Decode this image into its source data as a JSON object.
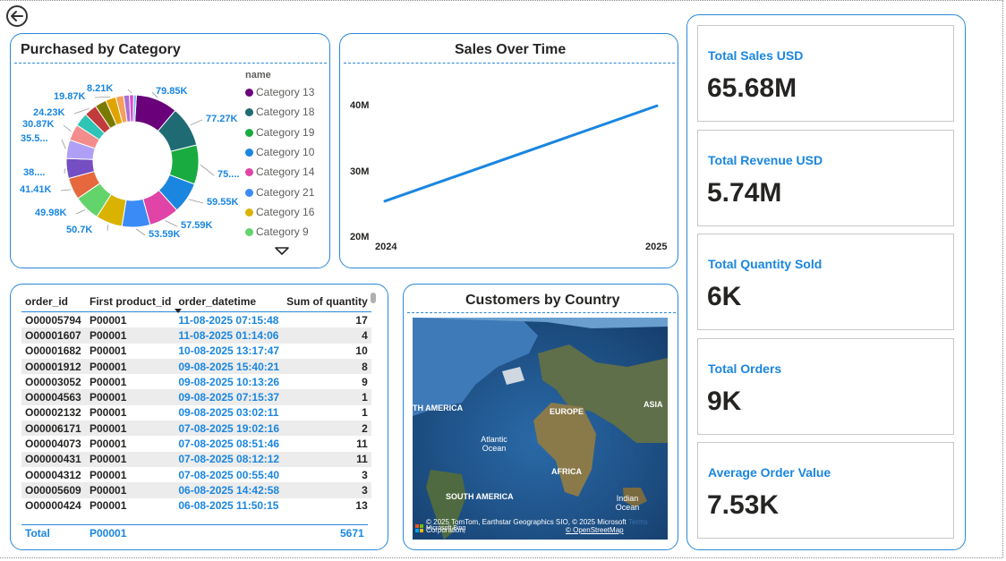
{
  "nav": {
    "back_icon": "back-arrow-icon"
  },
  "donut_panel": {
    "title": "Purchased by Category",
    "legend_title": "name",
    "legend": [
      {
        "label": "Category 13",
        "color": "#6b007b"
      },
      {
        "label": "Category 18",
        "color": "#1f6b73"
      },
      {
        "label": "Category 19",
        "color": "#1aab40"
      },
      {
        "label": "Category 10",
        "color": "#1a86e0"
      },
      {
        "label": "Category 14",
        "color": "#e044a7"
      },
      {
        "label": "Category 21",
        "color": "#3a8bf5"
      },
      {
        "label": "Category 16",
        "color": "#d9b300"
      },
      {
        "label": "Category 9",
        "color": "#62d46b"
      }
    ]
  },
  "line_panel": {
    "title": "Sales Over Time"
  },
  "map_panel": {
    "title": "Customers by Country",
    "labels": {
      "north_america": "TH AMERICA",
      "europe": "EUROPE",
      "asia": "ASIA",
      "atlantic": "Atlantic Ocean",
      "africa": "AFRICA",
      "south_america": "SOUTH AMERICA",
      "indian": "Indian Ocean"
    },
    "credit": "© 2025 TomTom, Earthstar Geographics SIO, © 2025 Microsoft Corporation,",
    "credit_link": "© OpenStreetMap",
    "terms": "Terms",
    "bing": "Microsoft Bing"
  },
  "table": {
    "columns": [
      "order_id",
      "First product_id",
      "order_datetime",
      "Sum of quantity"
    ],
    "rows": [
      [
        "O00005794",
        "P00001",
        "11-08-2025 07:15:48",
        "17"
      ],
      [
        "O00001607",
        "P00001",
        "11-08-2025 01:14:06",
        "4"
      ],
      [
        "O00001682",
        "P00001",
        "10-08-2025 13:17:47",
        "10"
      ],
      [
        "O00001912",
        "P00001",
        "09-08-2025 15:40:21",
        "8"
      ],
      [
        "O00003052",
        "P00001",
        "09-08-2025 10:13:26",
        "9"
      ],
      [
        "O00004563",
        "P00001",
        "09-08-2025 07:15:37",
        "1"
      ],
      [
        "O00002132",
        "P00001",
        "09-08-2025 03:02:11",
        "1"
      ],
      [
        "O00006171",
        "P00001",
        "07-08-2025 19:02:16",
        "2"
      ],
      [
        "O00004073",
        "P00001",
        "07-08-2025 08:51:46",
        "11"
      ],
      [
        "O00000431",
        "P00001",
        "07-08-2025 08:12:12",
        "11"
      ],
      [
        "O00004312",
        "P00001",
        "07-08-2025 00:55:40",
        "3"
      ],
      [
        "O00005609",
        "P00001",
        "06-08-2025 14:42:58",
        "3"
      ],
      [
        "O00000424",
        "P00001",
        "06-08-2025 11:50:15",
        "13"
      ]
    ],
    "total": {
      "label": "Total",
      "product": "P00001",
      "quantity": "5671"
    }
  },
  "kpis": [
    {
      "label": "Total Sales USD",
      "value": "65.68M"
    },
    {
      "label": "Total Revenue USD",
      "value": "5.74M"
    },
    {
      "label": "Total Quantity Sold",
      "value": "6K"
    },
    {
      "label": "Total Orders",
      "value": "9K"
    },
    {
      "label": "Average Order Value",
      "value": "7.53K"
    }
  ],
  "chart_data": [
    {
      "type": "pie",
      "title": "Purchased by Category",
      "legend_title": "name",
      "slices": [
        {
          "label": "79.85K",
          "value": 79850,
          "color": "#6b007b"
        },
        {
          "label": "77.27K",
          "value": 77270,
          "color": "#1f6b73"
        },
        {
          "label": "75....",
          "value": 75000,
          "color": "#1aab40"
        },
        {
          "label": "59.55K",
          "value": 59550,
          "color": "#1a86e0"
        },
        {
          "label": "57.59K",
          "value": 57590,
          "color": "#e044a7"
        },
        {
          "label": "53.59K",
          "value": 53590,
          "color": "#3a8bf5"
        },
        {
          "label": "50.7K",
          "value": 50700,
          "color": "#d9b300"
        },
        {
          "label": "49.98K",
          "value": 49980,
          "color": "#62d46b"
        },
        {
          "label": "41.41K",
          "value": 41410,
          "color": "#e6683c"
        },
        {
          "label": "38....",
          "value": 38000,
          "color": "#744ec2"
        },
        {
          "label": "35.5...",
          "value": 35500,
          "color": "#b0a0f5"
        },
        {
          "label": "30.87K",
          "value": 30870,
          "color": "#f38c8c"
        },
        {
          "label": "",
          "value": 26000,
          "color": "#2ec4b6"
        },
        {
          "label": "24.23K",
          "value": 24230,
          "color": "#c03b3b"
        },
        {
          "label": "",
          "value": 22000,
          "color": "#7a7a00"
        },
        {
          "label": "19.87K",
          "value": 19870,
          "color": "#e0a400"
        },
        {
          "label": "",
          "value": 15000,
          "color": "#f5a05a"
        },
        {
          "label": "",
          "value": 11000,
          "color": "#a86fd6"
        },
        {
          "label": "8.21K",
          "value": 8210,
          "color": "#e04ad0"
        },
        {
          "label": "",
          "value": 5000,
          "color": "#5bc0eb"
        }
      ]
    },
    {
      "type": "line",
      "title": "Sales Over Time",
      "x": [
        "2024",
        "2025"
      ],
      "y_ticks": [
        "20M",
        "30M",
        "40M"
      ],
      "ylim": [
        20000000,
        40000000
      ],
      "series": [
        {
          "values": [
            25600000,
            40100000
          ],
          "color": "#1a86e0"
        }
      ]
    }
  ]
}
